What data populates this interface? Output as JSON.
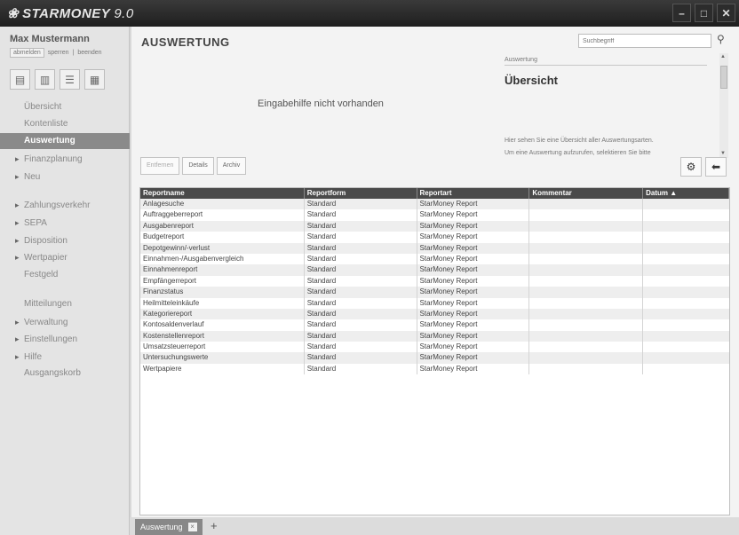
{
  "app": {
    "logo_mark": "❀",
    "logo_text": "STARMONEY",
    "version": "9.0"
  },
  "window": {
    "minimize": "–",
    "maximize": "□",
    "close": "✕"
  },
  "sidebar": {
    "user_name": "Max Mustermann",
    "user_actions": [
      "abmelden",
      "sperren",
      "beenden"
    ],
    "tools": [
      "▤",
      "▥",
      "☰",
      "▦"
    ],
    "items": [
      {
        "label": "Übersicht"
      },
      {
        "label": "Kontenliste"
      },
      {
        "label": "Auswertung",
        "selected": true
      },
      {
        "label": "Finanzplanung"
      },
      {
        "label": "Neu"
      },
      {
        "label": "Zahlungsverkehr"
      },
      {
        "label": "SEPA"
      },
      {
        "label": "Disposition"
      },
      {
        "label": "Wertpapier"
      },
      {
        "label": "Festgeld"
      },
      {
        "label": "Mitteilungen"
      },
      {
        "label": "Verwaltung"
      },
      {
        "label": "Einstellungen"
      },
      {
        "label": "Hilfe"
      },
      {
        "label": "Ausgangskorb"
      }
    ]
  },
  "main": {
    "title": "AUSWERTUNG",
    "search": {
      "placeholder": "Suchbegriff",
      "go_icon": "⚲"
    },
    "help_text": "Eingabehilfe nicht vorhanden",
    "info": {
      "caption": "Auswertung",
      "heading": "Übersicht",
      "line1": "Hier sehen Sie eine Übersicht aller Auswertungsarten.",
      "line2": "Um eine Auswertung aufzurufen, selektieren Sie bitte"
    },
    "buttons": [
      "Entfernen",
      "Details",
      "Archiv"
    ],
    "icon_buttons": {
      "settings": "⚙",
      "back": "⬅"
    }
  },
  "table": {
    "columns": [
      "Reportname",
      "Reportform",
      "Reportart",
      "Kommentar",
      "Datum ▲"
    ],
    "rows": [
      [
        "Anlagesuche",
        "Standard",
        "StarMoney Report"
      ],
      [
        "Auftraggeberreport",
        "Standard",
        "StarMoney Report"
      ],
      [
        "Ausgabenreport",
        "Standard",
        "StarMoney Report"
      ],
      [
        "Budgetreport",
        "Standard",
        "StarMoney Report"
      ],
      [
        "Depotgewinn/-verlust",
        "Standard",
        "StarMoney Report"
      ],
      [
        "Einnahmen-/Ausgabenvergleich",
        "Standard",
        "StarMoney Report"
      ],
      [
        "Einnahmenreport",
        "Standard",
        "StarMoney Report"
      ],
      [
        "Empfängerreport",
        "Standard",
        "StarMoney Report"
      ],
      [
        "Finanzstatus",
        "Standard",
        "StarMoney Report"
      ],
      [
        "Heilmitteleinkäufe",
        "Standard",
        "StarMoney Report"
      ],
      [
        "Kategoriereport",
        "Standard",
        "StarMoney Report"
      ],
      [
        "Kontosaldenverlauf",
        "Standard",
        "StarMoney Report"
      ],
      [
        "Kostenstellenreport",
        "Standard",
        "StarMoney Report"
      ],
      [
        "Umsatzsteuerreport",
        "Standard",
        "StarMoney Report"
      ],
      [
        "Untersuchungswerte",
        "Standard",
        "StarMoney Report"
      ],
      [
        "Wertpapiere",
        "Standard",
        "StarMoney Report"
      ]
    ]
  },
  "tabs": [
    {
      "label": "Auswertung"
    }
  ],
  "tabbar": {
    "add": "+",
    "close": "×"
  }
}
